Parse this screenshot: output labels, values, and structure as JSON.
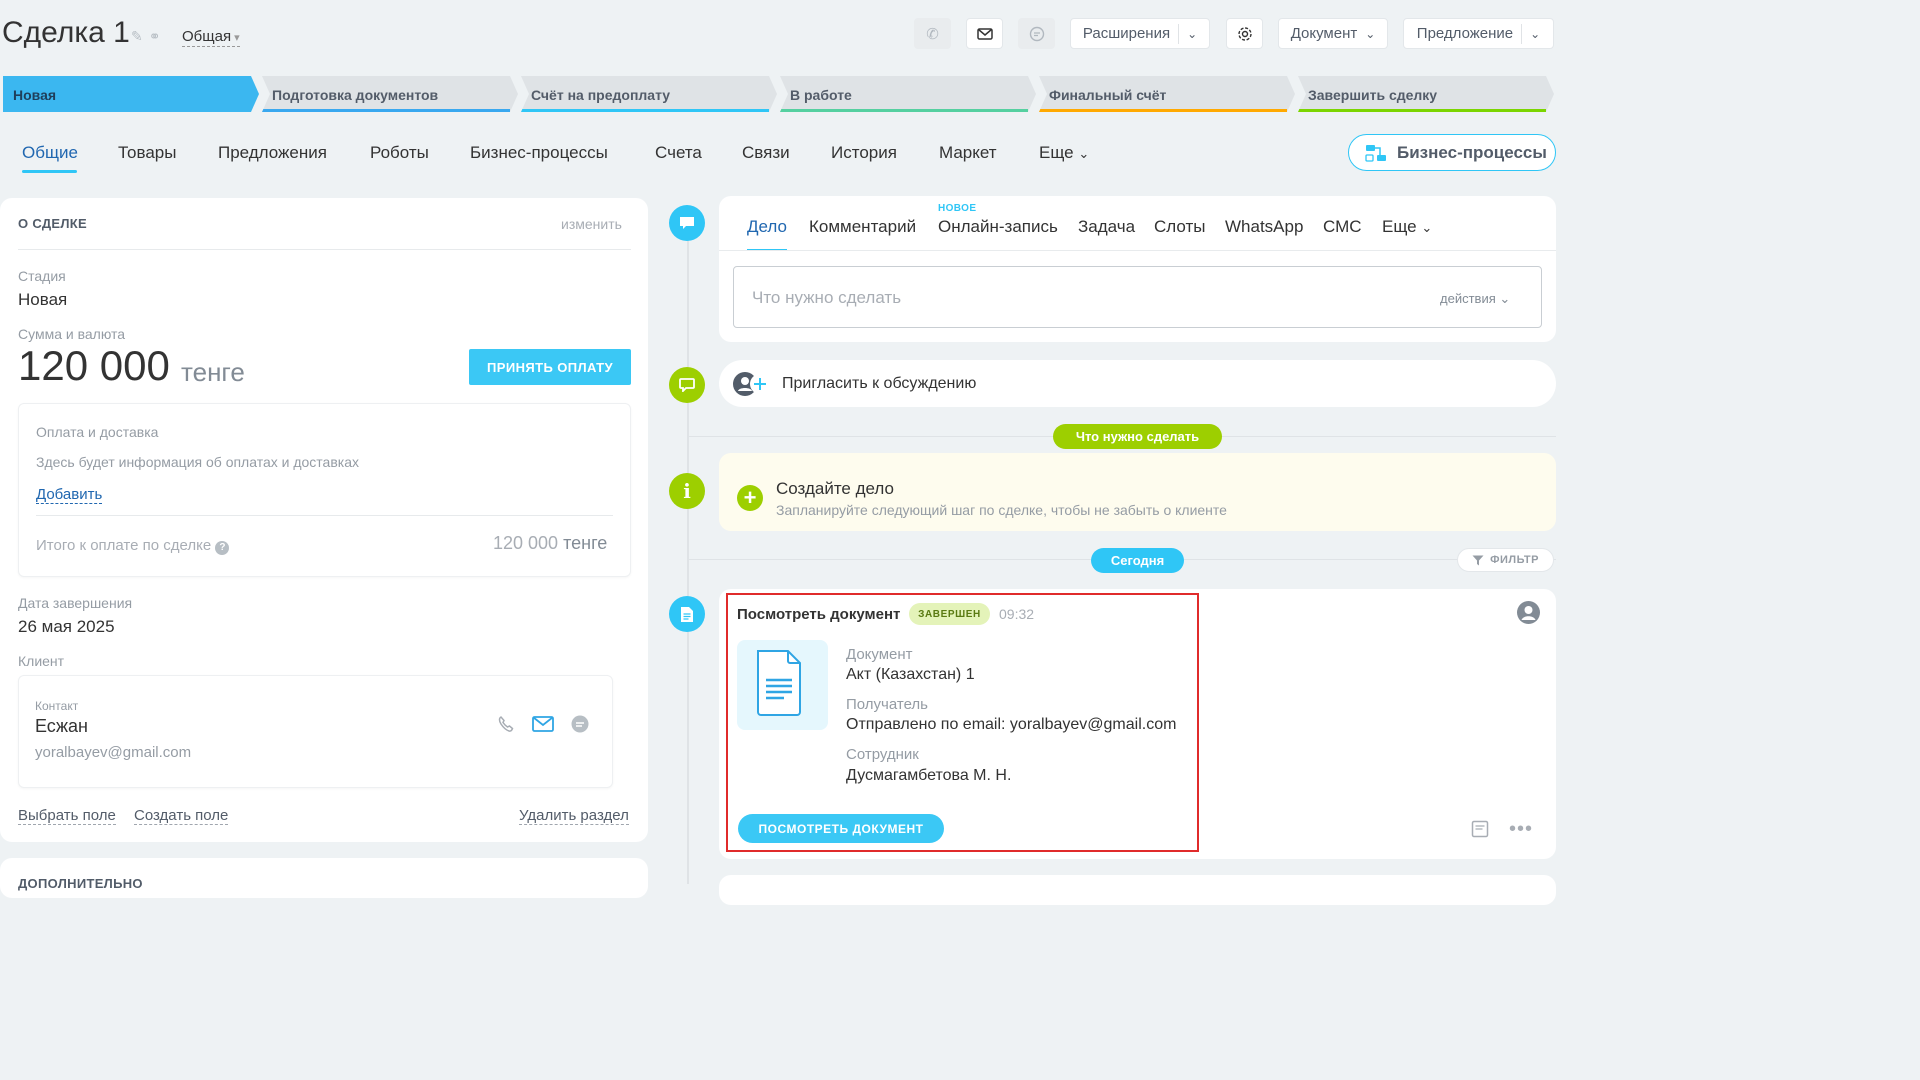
{
  "header": {
    "title": "Сделка 1",
    "category": "Общая",
    "buttons": {
      "extensions": "Расширения",
      "document": "Документ",
      "proposal": "Предложение"
    }
  },
  "stages": [
    {
      "label": "Новая",
      "color": "#3bb7f0"
    },
    {
      "label": "Подготовка документов",
      "color": "#39a8ef"
    },
    {
      "label": "Счёт на предоплату",
      "color": "#2fc6f6"
    },
    {
      "label": "В работе",
      "color": "#55d0a0"
    },
    {
      "label": "Финальный счёт",
      "color": "#ffa900"
    },
    {
      "label": "Завершить сделку",
      "color": "#7bd500"
    }
  ],
  "tabs": [
    "Общие",
    "Товары",
    "Предложения",
    "Роботы",
    "Бизнес-процессы",
    "Счета",
    "Связи",
    "История",
    "Маркет",
    "Еще"
  ],
  "bp_button": "Бизнес-процессы",
  "about": {
    "title": "О СДЕЛКЕ",
    "edit": "изменить",
    "stage_label": "Стадия",
    "stage_value": "Новая",
    "amount_label": "Сумма и валюта",
    "amount": "120 000",
    "currency": "тенге",
    "pay_button": "ПРИНЯТЬ ОПЛАТУ",
    "payment": {
      "title": "Оплата и доставка",
      "info": "Здесь будет информация об оплатах и доставках",
      "add": "Добавить",
      "total_label": "Итого к оплате по сделке",
      "total_amount": "120 000",
      "total_currency": "тенге"
    },
    "close_date_label": "Дата завершения",
    "close_date": "26 мая 2025",
    "client_label": "Клиент",
    "contact": {
      "label": "Контакт",
      "name": "Есжан",
      "email": "yoralbayev@gmail.com"
    },
    "footer": {
      "select_field": "Выбрать поле",
      "create_field": "Создать поле",
      "delete_section": "Удалить раздел"
    },
    "next_section": "ДОПОЛНИТЕЛЬНО"
  },
  "composer": {
    "tabs": [
      "Дело",
      "Комментарий",
      "Онлайн-запись",
      "Задача",
      "Слоты",
      "WhatsApp",
      "СМС",
      "Еще"
    ],
    "new_badge": "НОВОЕ",
    "placeholder": "Что нужно сделать",
    "actions": "действия"
  },
  "invite": "Пригласить к обсуждению",
  "todo_pill": "Что нужно сделать",
  "create": {
    "title": "Создайте дело",
    "subtitle": "Запланируйте следующий шаг по сделке, чтобы не забыть о клиенте"
  },
  "today_pill": "Сегодня",
  "filter": "ФИЛЬТР",
  "doc_event": {
    "title": "Посмотреть документ",
    "status": "ЗАВЕРШЕН",
    "time": "09:32",
    "doc_label": "Документ",
    "doc_value": "Акт (Казахстан) 1",
    "recipient_label": "Получатель",
    "recipient_value": "Отправлено по email: yoralbayev@gmail.com",
    "employee_label": "Сотрудник",
    "employee_value": "Дусмагамбетова М. Н.",
    "button": "ПОСМОТРЕТЬ ДОКУМЕНТ"
  }
}
